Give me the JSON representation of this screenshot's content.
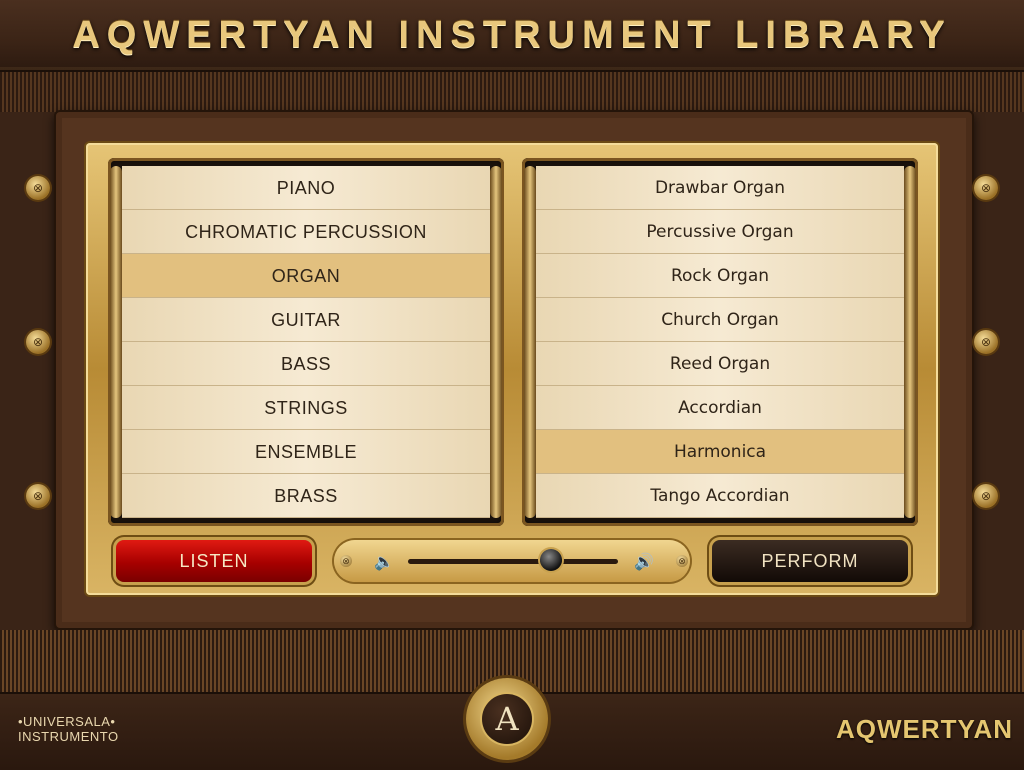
{
  "header": {
    "title": "AQWERTYAN INSTRUMENT LIBRARY"
  },
  "categories": {
    "items": [
      "PIANO",
      "CHROMATIC PERCUSSION",
      "ORGAN",
      "GUITAR",
      "BASS",
      "STRINGS",
      "ENSEMBLE",
      "BRASS"
    ],
    "selected": "ORGAN"
  },
  "instruments": {
    "items": [
      "Drawbar Organ",
      "Percussive  Organ",
      "Rock Organ",
      "Church Organ",
      "Reed Organ",
      "Accordian",
      "Harmonica",
      "Tango Accordian"
    ],
    "selected": "Harmonica"
  },
  "controls": {
    "listen_label": "LISTEN",
    "perform_label": "PERFORM",
    "volume_level": 0.68
  },
  "footer": {
    "brand_left_line1": "•UNIVERSALA•",
    "brand_left_line2": "INSTRUMENTO",
    "brand_right": "AQWERTYAN",
    "logo_letter": "A"
  },
  "icons": {
    "volume_low": "speaker-low-icon",
    "volume_high": "speaker-high-icon"
  },
  "colors": {
    "gold": "#e8c77c",
    "listen_red": "#c40000",
    "selected_row": "#e2c07f"
  }
}
